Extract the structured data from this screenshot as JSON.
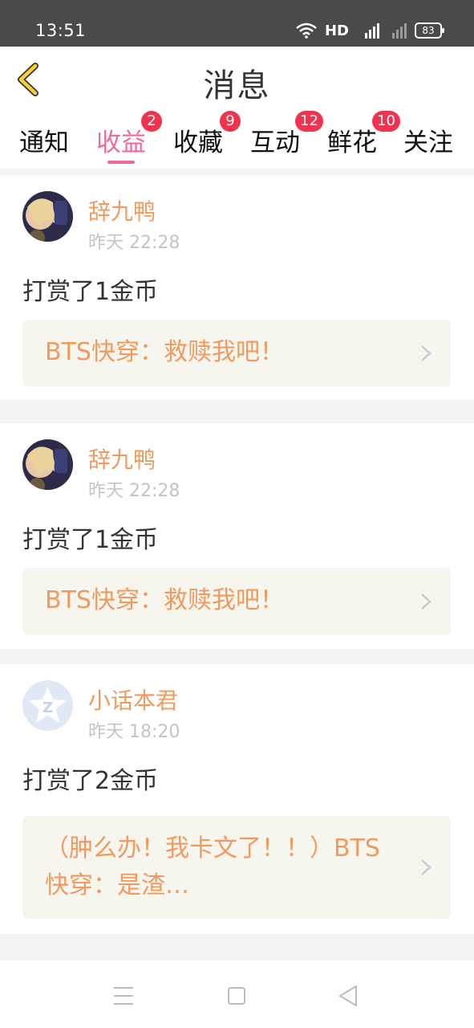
{
  "status": {
    "time": "13:51",
    "network_label": "HD",
    "signal_label": "4G",
    "battery": "83"
  },
  "header": {
    "title": "消息"
  },
  "tabs": [
    {
      "label": "通知",
      "badge": ""
    },
    {
      "label": "收益",
      "badge": "2",
      "active": true
    },
    {
      "label": "收藏",
      "badge": "9"
    },
    {
      "label": "互动",
      "badge": "12"
    },
    {
      "label": "鲜花",
      "badge": "10"
    },
    {
      "label": "关注",
      "badge": ""
    }
  ],
  "messages": [
    {
      "user": "辞九鸭",
      "time": "昨天 22:28",
      "text": "打赏了1金币",
      "quote": "BTS快穿：救赎我吧！"
    },
    {
      "user": "辞九鸭",
      "time": "昨天 22:28",
      "text": "打赏了1金币",
      "quote": "BTS快穿：救赎我吧！"
    },
    {
      "user": "小话本君",
      "time": "昨天 18:20",
      "text": "打赏了2金币",
      "quote": "（肿么办！我卡文了！！）BTS快穿：是渣…"
    }
  ],
  "colors": {
    "accent": "#ee6a9c",
    "name": "#ef9a5f",
    "badge": "#f0334f",
    "back_arrow": "#f5cf3b"
  },
  "icons": {
    "back": "chevron-left-icon",
    "menu": "menu-icon",
    "home": "square-icon",
    "nav_back": "triangle-back-icon"
  }
}
